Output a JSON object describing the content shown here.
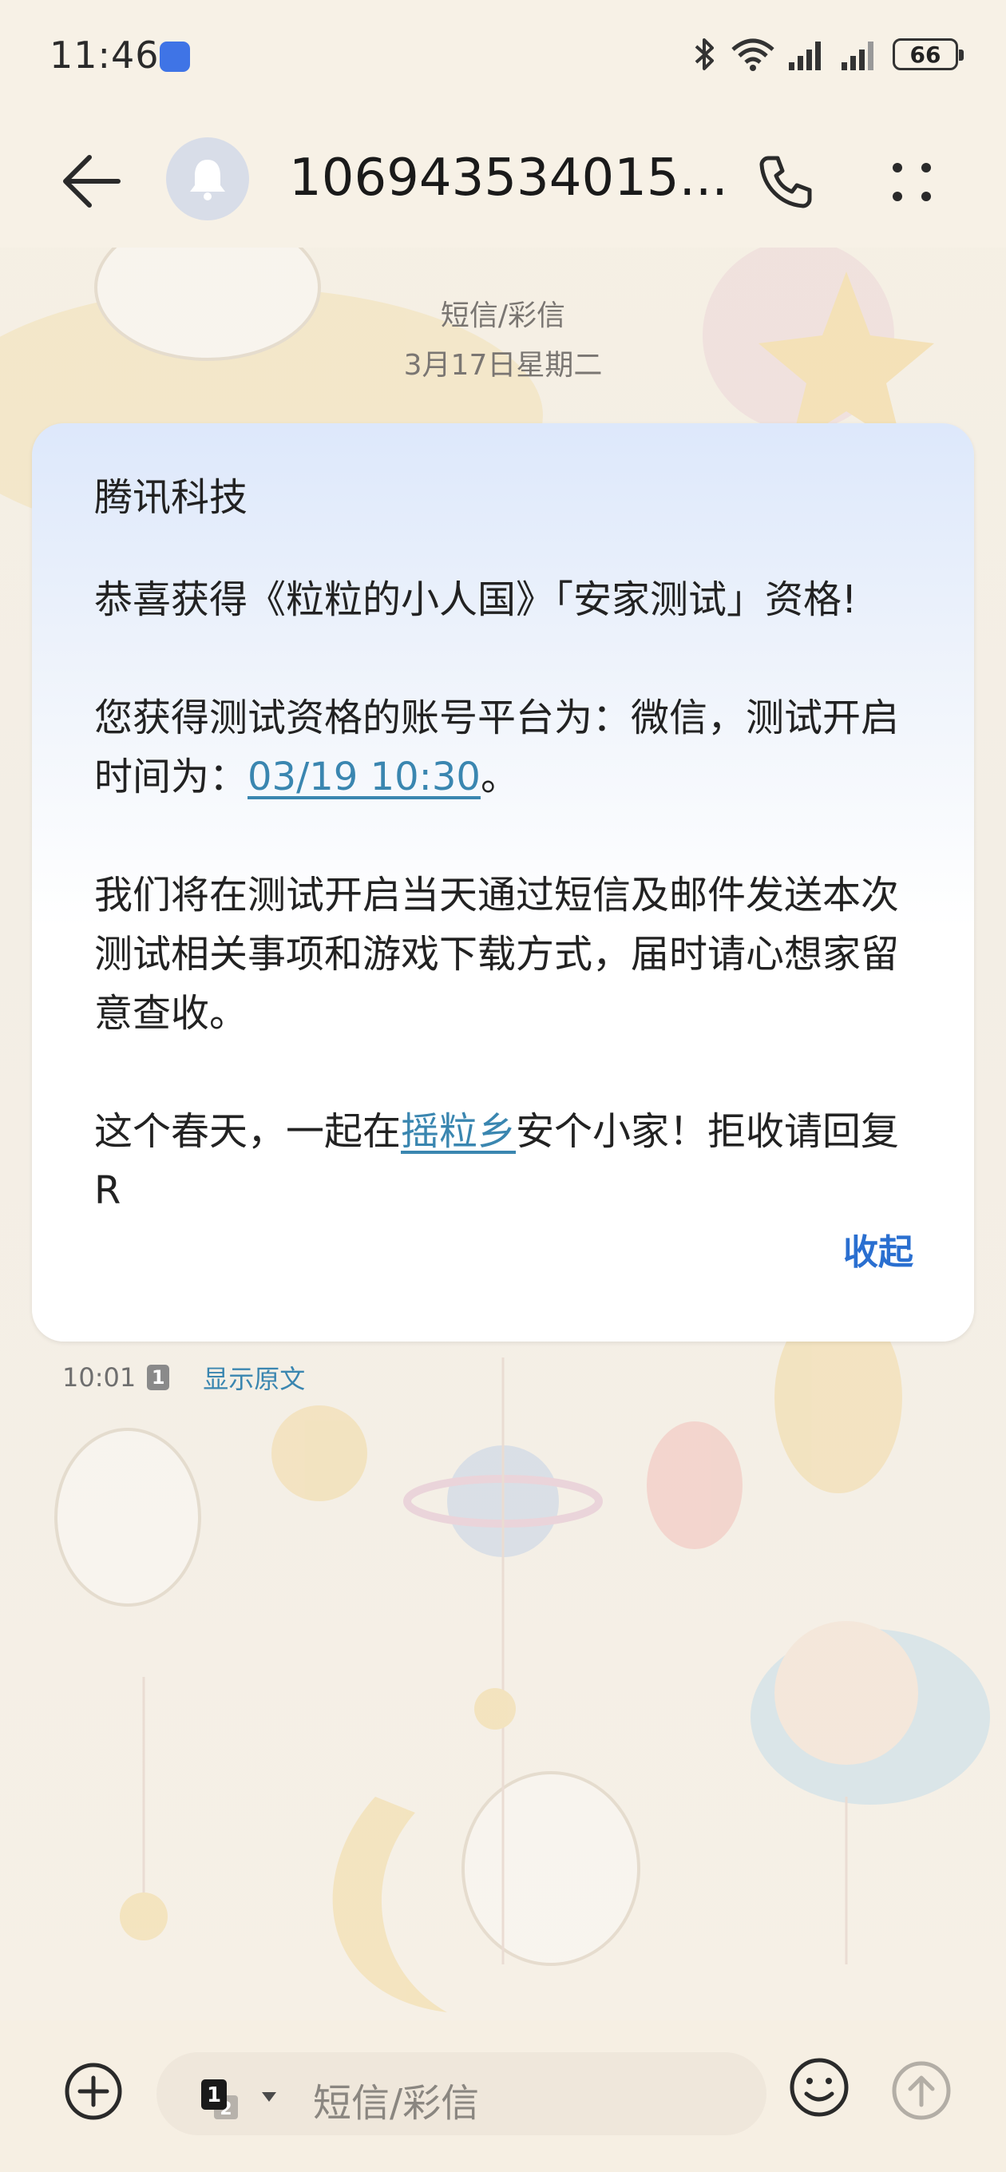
{
  "status_bar": {
    "time": "11:46",
    "battery": "66",
    "icons": [
      "bluetooth-icon",
      "wifi-icon",
      "signal-icon",
      "signal-icon",
      "battery-icon"
    ]
  },
  "header": {
    "contact_title": "106943534015...",
    "avatar_icon": "bell-icon"
  },
  "conversation": {
    "type_label": "短信/彩信",
    "date_label": "3月17日星期二",
    "message": {
      "sender": "腾讯科技",
      "line1": "恭喜获得《粒粒的小人国》「安家测试」资格!",
      "line2_prefix": "您获得测试资格的账号平台为：微信，测试开启时间为：",
      "line2_link": "03/19 10:30",
      "line2_suffix": "。",
      "line3": "我们将在测试开启当天通过短信及邮件发送本次测试相关事项和游戏下载方式，届时请心想家留意查收。",
      "line4_prefix": "这个春天，一起在",
      "line4_link": "摇粒乡",
      "line4_suffix": "安个小家！拒收请回复R",
      "collapse_label": "收起"
    },
    "meta": {
      "time": "10:01",
      "sim": "1",
      "show_original": "显示原文"
    }
  },
  "input_bar": {
    "placeholder": "短信/彩信",
    "sim_primary": "1",
    "sim_secondary": "2"
  },
  "colors": {
    "background": "#f7f1e6",
    "link": "#3a86b0",
    "collapse": "#2a6fd0",
    "app_dot": "#3f74e6"
  }
}
